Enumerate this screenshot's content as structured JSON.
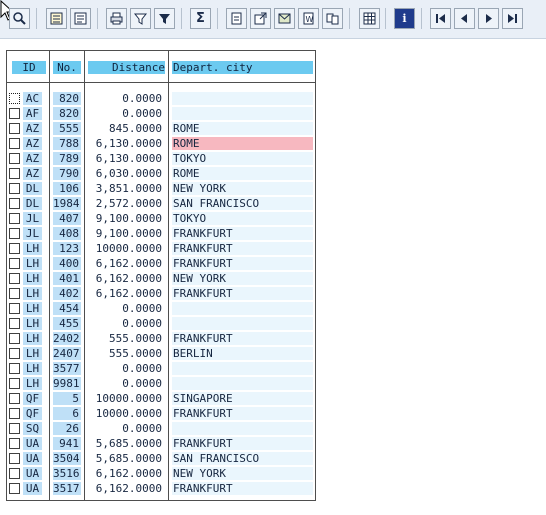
{
  "toolbar": {
    "buttons": [
      {
        "name": "details-icon"
      },
      {
        "name": "sort-ascending-icon"
      },
      {
        "name": "sort-descending-icon"
      },
      {
        "name": "print-icon"
      },
      {
        "name": "filter-icon"
      },
      {
        "name": "set-filter-icon"
      },
      {
        "name": "sum-icon"
      },
      {
        "name": "subtotal-icon"
      },
      {
        "name": "export-icon"
      },
      {
        "name": "send-icon"
      },
      {
        "name": "word-processing-icon"
      },
      {
        "name": "abc-analysis-icon"
      },
      {
        "name": "layout-grid-icon"
      },
      {
        "name": "info-icon"
      },
      {
        "name": "first-page-icon"
      },
      {
        "name": "previous-page-icon"
      },
      {
        "name": "next-page-icon"
      },
      {
        "name": "last-page-icon"
      }
    ],
    "sum_symbol": "Σ",
    "info_symbol": "i"
  },
  "table": {
    "headers": {
      "id": " ID ",
      "no": "No.",
      "distance": "Distance",
      "city": "Depart. city"
    },
    "rows": [
      {
        "id": "AC",
        "no": "820",
        "distance": "0.0000",
        "city": ""
      },
      {
        "id": "AF",
        "no": "820",
        "distance": "0.0000",
        "city": ""
      },
      {
        "id": "AZ",
        "no": "555",
        "distance": "845.0000",
        "city": "ROME"
      },
      {
        "id": "AZ",
        "no": "788",
        "distance": "6,130.0000",
        "city": "ROME",
        "highlight": true
      },
      {
        "id": "AZ",
        "no": "789",
        "distance": "6,130.0000",
        "city": "TOKYO"
      },
      {
        "id": "AZ",
        "no": "790",
        "distance": "6,030.0000",
        "city": "ROME"
      },
      {
        "id": "DL",
        "no": "106",
        "distance": "3,851.0000",
        "city": "NEW YORK"
      },
      {
        "id": "DL",
        "no": "1984",
        "distance": "2,572.0000",
        "city": "SAN FRANCISCO"
      },
      {
        "id": "JL",
        "no": "407",
        "distance": "9,100.0000",
        "city": "TOKYO"
      },
      {
        "id": "JL",
        "no": "408",
        "distance": "9,100.0000",
        "city": "FRANKFURT"
      },
      {
        "id": "LH",
        "no": "123",
        "distance": "10000.0000",
        "city": "FRANKFURT"
      },
      {
        "id": "LH",
        "no": "400",
        "distance": "6,162.0000",
        "city": "FRANKFURT"
      },
      {
        "id": "LH",
        "no": "401",
        "distance": "6,162.0000",
        "city": "NEW YORK"
      },
      {
        "id": "LH",
        "no": "402",
        "distance": "6,162.0000",
        "city": "FRANKFURT"
      },
      {
        "id": "LH",
        "no": "454",
        "distance": "0.0000",
        "city": ""
      },
      {
        "id": "LH",
        "no": "455",
        "distance": "0.0000",
        "city": ""
      },
      {
        "id": "LH",
        "no": "2402",
        "distance": "555.0000",
        "city": "FRANKFURT"
      },
      {
        "id": "LH",
        "no": "2407",
        "distance": "555.0000",
        "city": "BERLIN"
      },
      {
        "id": "LH",
        "no": "3577",
        "distance": "0.0000",
        "city": ""
      },
      {
        "id": "LH",
        "no": "9981",
        "distance": "0.0000",
        "city": ""
      },
      {
        "id": "QF",
        "no": "5",
        "distance": "10000.0000",
        "city": "SINGAPORE"
      },
      {
        "id": "QF",
        "no": "6",
        "distance": "10000.0000",
        "city": "FRANKFURT"
      },
      {
        "id": "SQ",
        "no": "26",
        "distance": "0.0000",
        "city": ""
      },
      {
        "id": "UA",
        "no": "941",
        "distance": "5,685.0000",
        "city": "FRANKFURT"
      },
      {
        "id": "UA",
        "no": "3504",
        "distance": "5,685.0000",
        "city": "SAN FRANCISCO"
      },
      {
        "id": "UA",
        "no": "3516",
        "distance": "6,162.0000",
        "city": "NEW YORK"
      },
      {
        "id": "UA",
        "no": "3517",
        "distance": "6,162.0000",
        "city": "FRANKFURT"
      }
    ]
  },
  "colors": {
    "header_bg": "#6ccaf0",
    "key_col_bg": "#bfe0f7",
    "city_col_bg": "#eaf6fd",
    "highlight_bg": "#f7b8c0"
  }
}
